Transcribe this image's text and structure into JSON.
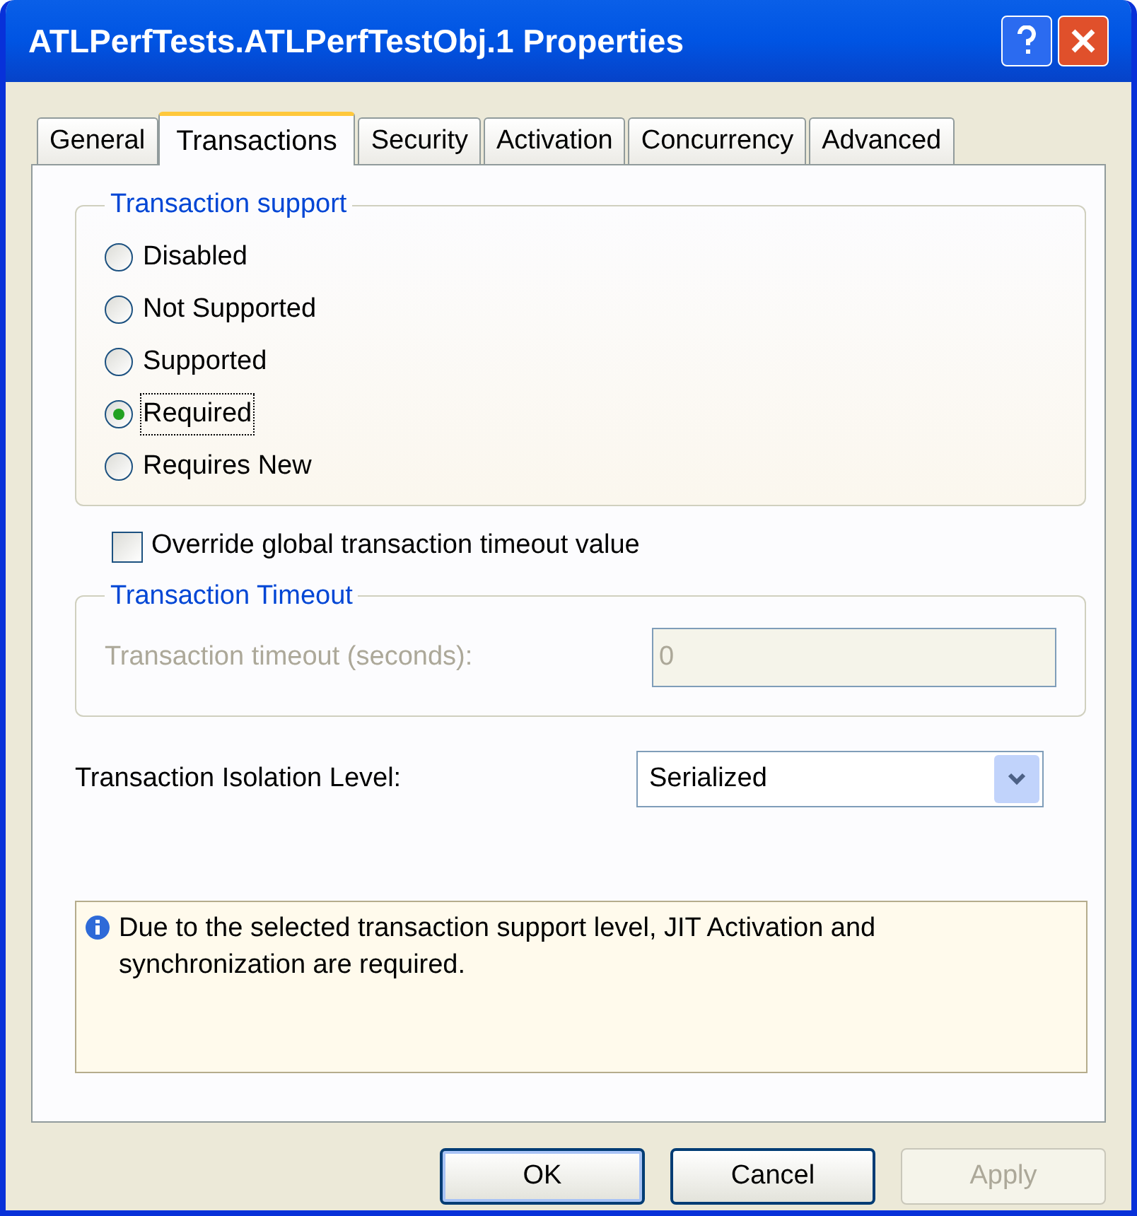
{
  "window": {
    "title": "ATLPerfTests.ATLPerfTestObj.1 Properties"
  },
  "tabs": [
    {
      "label": "General",
      "selected": false
    },
    {
      "label": "Transactions",
      "selected": true
    },
    {
      "label": "Security",
      "selected": false
    },
    {
      "label": "Activation",
      "selected": false
    },
    {
      "label": "Concurrency",
      "selected": false
    },
    {
      "label": "Advanced",
      "selected": false
    }
  ],
  "transaction_support": {
    "title": "Transaction support",
    "options": [
      {
        "label": "Disabled",
        "selected": false,
        "focused": false
      },
      {
        "label": "Not Supported",
        "selected": false,
        "focused": false
      },
      {
        "label": "Supported",
        "selected": false,
        "focused": false
      },
      {
        "label": "Required",
        "selected": true,
        "focused": true
      },
      {
        "label": "Requires New",
        "selected": false,
        "focused": false
      }
    ]
  },
  "override_checkbox": {
    "label": "Override global transaction timeout value",
    "checked": false
  },
  "transaction_timeout": {
    "title": "Transaction Timeout",
    "label": "Transaction timeout (seconds):",
    "value": "0",
    "disabled": true
  },
  "isolation_level": {
    "label": "Transaction Isolation Level:",
    "value": "Serialized"
  },
  "info": {
    "text": "Due to the selected transaction support level, JIT Activation and synchronization are required."
  },
  "buttons": [
    {
      "label": "OK",
      "disabled": false,
      "default": true
    },
    {
      "label": "Cancel",
      "disabled": false,
      "default": false
    },
    {
      "label": "Apply",
      "disabled": true,
      "default": false
    }
  ]
}
